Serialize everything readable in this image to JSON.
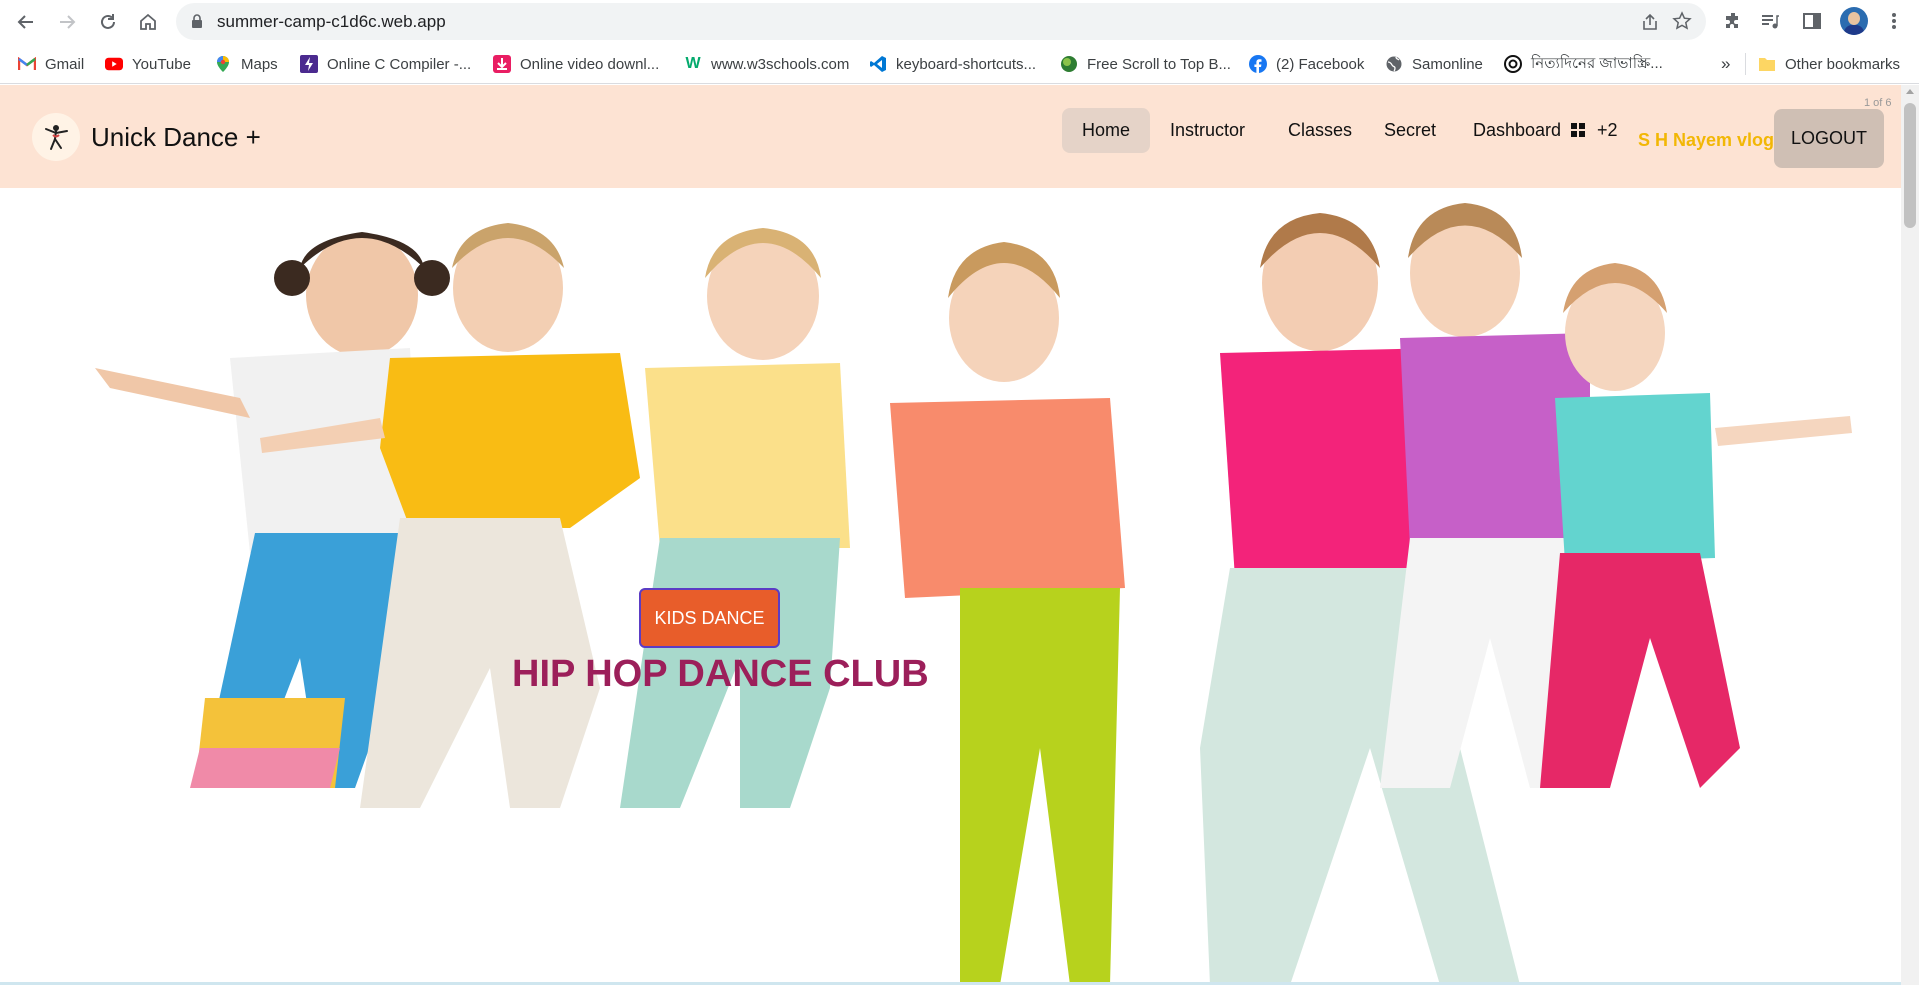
{
  "browser": {
    "url": "summer-camp-c1d6c.web.app",
    "bookmarks": [
      {
        "label": "Gmail",
        "icon": "gmail-icon"
      },
      {
        "label": "YouTube",
        "icon": "youtube-icon"
      },
      {
        "label": "Maps",
        "icon": "maps-icon"
      },
      {
        "label": "Online C Compiler -...",
        "icon": "compiler-icon"
      },
      {
        "label": "Online video downl...",
        "icon": "download-icon"
      },
      {
        "label": "www.w3schools.com",
        "icon": "w3schools-icon"
      },
      {
        "label": "keyboard-shortcuts...",
        "icon": "vscode-icon"
      },
      {
        "label": "Free Scroll to Top B...",
        "icon": "scroll-icon"
      },
      {
        "label": "(2) Facebook",
        "icon": "facebook-icon"
      },
      {
        "label": "Samonline",
        "icon": "globe-icon"
      },
      {
        "label": "নিত্যদিনের জাভাস্ক্রি...",
        "icon": "threads-icon"
      }
    ],
    "overflow_label": "»",
    "other_bookmarks": "Other bookmarks"
  },
  "site": {
    "brand": "Unick Dance +",
    "menu": {
      "home": "Home",
      "instructor": "Instructor",
      "classes": "Classes",
      "secret": "Secret",
      "dashboard": "Dashboard",
      "dashboard_badge": "+2"
    },
    "user_name": "S H Nayem vlogs",
    "logout": "LOGOUT",
    "pager": "1 of 6"
  },
  "hero": {
    "button": "KIDS DANCE",
    "title": "HIP HOP DANCE CLUB"
  },
  "colors": {
    "navbar_bg": "#fde3d3",
    "active_menu_bg": "#e5d3c8",
    "user_name": "#f2b705",
    "kids_button": "#e85d2a",
    "hero_title": "#9c1f5a"
  }
}
